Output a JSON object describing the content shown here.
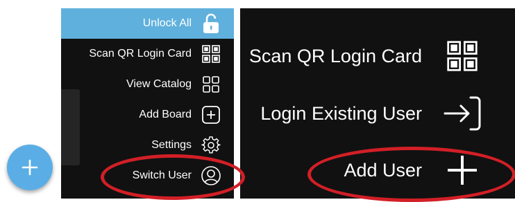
{
  "left_menu": {
    "items": [
      {
        "label": "Unlock All",
        "icon": "unlock-icon",
        "highlighted": true
      },
      {
        "label": "Scan QR Login Card",
        "icon": "qr-code-icon"
      },
      {
        "label": "View Catalog",
        "icon": "grid-icon"
      },
      {
        "label": "Add Board",
        "icon": "plus-box-icon"
      },
      {
        "label": "Settings",
        "icon": "gear-icon"
      },
      {
        "label": "Switch User",
        "icon": "user-circle-icon"
      }
    ]
  },
  "right_menu": {
    "items": [
      {
        "label": "Scan QR Login Card",
        "icon": "qr-code-icon"
      },
      {
        "label": "Login Existing User",
        "icon": "login-arrow-icon"
      },
      {
        "label": "Add User",
        "icon": "plus-icon"
      }
    ]
  },
  "colors": {
    "menu_bg": "#111111",
    "highlight": "#5fb0dc",
    "fab": "#5aaee5",
    "annotation_ring": "#d21f26"
  }
}
